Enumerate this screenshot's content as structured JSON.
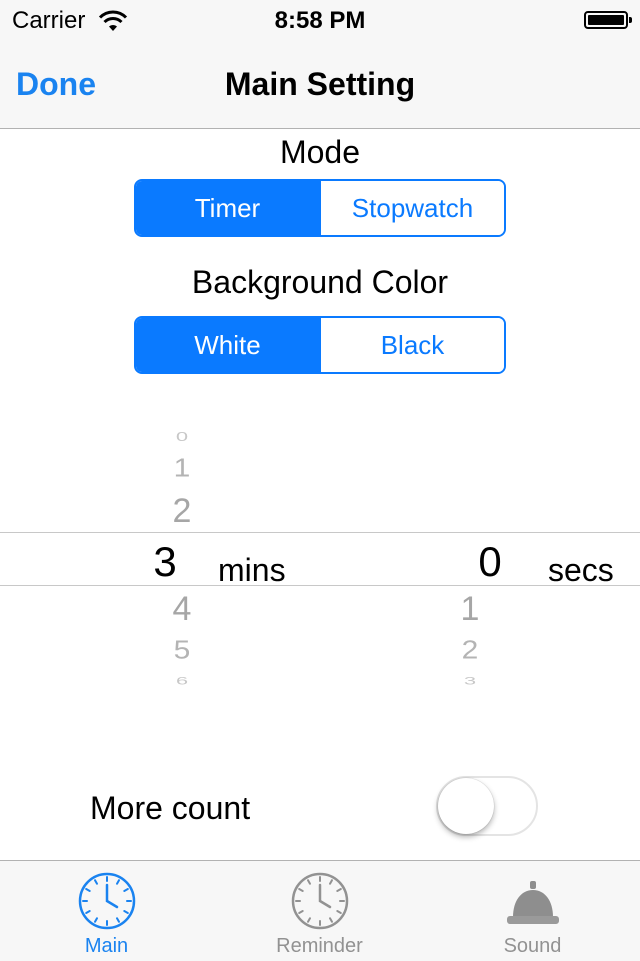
{
  "status_bar": {
    "carrier": "Carrier",
    "time": "8:58 PM"
  },
  "nav": {
    "done_label": "Done",
    "title": "Main Setting"
  },
  "mode": {
    "label": "Mode",
    "options": [
      "Timer",
      "Stopwatch"
    ],
    "selected": "Timer"
  },
  "background_color": {
    "label": "Background Color",
    "options": [
      "White",
      "Black"
    ],
    "selected": "White"
  },
  "picker": {
    "minutes": {
      "above": [
        "0",
        "1",
        "2"
      ],
      "selected": "3",
      "below": [
        "4",
        "5",
        "6"
      ],
      "unit": "mins"
    },
    "seconds": {
      "selected": "0",
      "below": [
        "1",
        "2",
        "3"
      ],
      "unit": "secs"
    }
  },
  "more_count": {
    "label": "More count",
    "enabled": false
  },
  "tabs": [
    {
      "label": "Main",
      "icon": "clock-icon",
      "active": true
    },
    {
      "label": "Reminder",
      "icon": "clock-icon",
      "active": false
    },
    {
      "label": "Sound",
      "icon": "bell-icon",
      "active": false
    }
  ],
  "colors": {
    "accent": "#0a7aff",
    "inactive": "#929292"
  }
}
